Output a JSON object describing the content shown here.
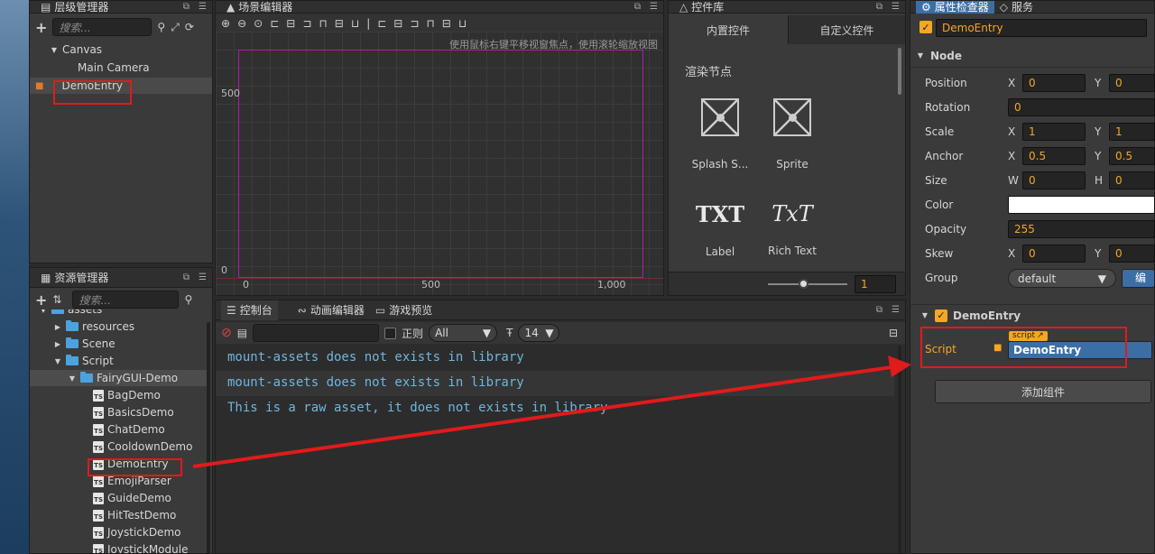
{
  "hierarchy": {
    "title": "层级管理器",
    "search_placeholder": "搜索...",
    "items": [
      "Canvas",
      "Main Camera",
      "DemoEntry"
    ]
  },
  "assets": {
    "title": "资源管理器",
    "search_placeholder": "搜索...",
    "items": [
      {
        "label": "assets",
        "type": "folder"
      },
      {
        "label": "resources",
        "type": "folder"
      },
      {
        "label": "Scene",
        "type": "folder"
      },
      {
        "label": "Script",
        "type": "folder"
      },
      {
        "label": "FairyGUI-Demo",
        "type": "folder"
      },
      {
        "label": "BagDemo",
        "type": "ts"
      },
      {
        "label": "BasicsDemo",
        "type": "ts"
      },
      {
        "label": "ChatDemo",
        "type": "ts"
      },
      {
        "label": "CooldownDemo",
        "type": "ts"
      },
      {
        "label": "DemoEntry",
        "type": "ts"
      },
      {
        "label": "EmojiParser",
        "type": "ts"
      },
      {
        "label": "GuideDemo",
        "type": "ts"
      },
      {
        "label": "HitTestDemo",
        "type": "ts"
      },
      {
        "label": "JoystickDemo",
        "type": "ts"
      },
      {
        "label": "JoystickModule",
        "type": "ts"
      }
    ]
  },
  "scene": {
    "title": "场景编辑器",
    "hint": "使用鼠标右键平移视窗焦点，使用滚轮缩放视图",
    "y_labels": [
      "500",
      "0"
    ],
    "x_labels": [
      "0",
      "500",
      "1,000"
    ]
  },
  "widgets": {
    "title": "控件库",
    "tab_builtin": "内置控件",
    "tab_custom": "自定义控件",
    "section": "渲染节点",
    "items": [
      {
        "label": "Splash S...",
        "glyph": "sprite-icon"
      },
      {
        "label": "Sprite",
        "glyph": "sprite-icon"
      },
      {
        "label": "Label",
        "glyph_text": "TXT"
      },
      {
        "label": "Rich Text",
        "glyph_text": "TxT"
      }
    ],
    "zoom_value": "1"
  },
  "console": {
    "tabs": [
      "控制台",
      "动画编辑器",
      "游戏预览"
    ],
    "regex_label": "正则",
    "filter_value": "All",
    "font_size": "14",
    "lines": [
      "mount-assets does not exists in library",
      "mount-assets does not exists in library",
      "This is a raw asset, it does not exists in library"
    ]
  },
  "inspector": {
    "tabs": [
      "属性检查器",
      "服务"
    ],
    "node_name": "DemoEntry",
    "node_section": "Node",
    "props": {
      "position": {
        "label": "Position",
        "x": "0",
        "y": "0"
      },
      "rotation": {
        "label": "Rotation",
        "value": "0"
      },
      "scale": {
        "label": "Scale",
        "x": "1",
        "y": "1"
      },
      "anchor": {
        "label": "Anchor",
        "x": "0.5",
        "y": "0.5"
      },
      "size": {
        "label": "Size",
        "w": "0",
        "h": "0"
      },
      "color": {
        "label": "Color"
      },
      "opacity": {
        "label": "Opacity",
        "value": "255"
      },
      "skew": {
        "label": "Skew",
        "x": "0",
        "y": "0"
      },
      "group": {
        "label": "Group",
        "value": "default",
        "edit": "编辑"
      }
    },
    "axis": {
      "x": "X",
      "y": "Y",
      "w": "W",
      "h": "H"
    },
    "component_section": "DemoEntry",
    "script_label": "Script",
    "script_badge": "script",
    "script_value": "DemoEntry",
    "add_component": "添加组件"
  },
  "colors": {
    "accent": "#3b6ea5",
    "highlight": "#f5a623",
    "annotation": "#e01b1b",
    "console_text": "#6fb6dc"
  }
}
